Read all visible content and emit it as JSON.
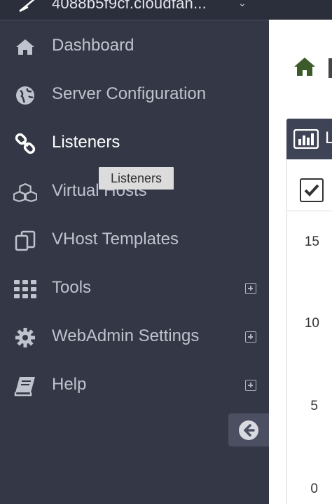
{
  "topbar": {
    "hostname": "4088b5f9cf.cloudfan...",
    "caret": "⌄"
  },
  "sidebar": {
    "items": [
      {
        "label": "Dashboard",
        "icon": "home-icon",
        "expandable": false
      },
      {
        "label": "Server Configuration",
        "icon": "globe-icon",
        "expandable": false
      },
      {
        "label": "Listeners",
        "icon": "link-icon",
        "expandable": false,
        "active": true
      },
      {
        "label": "Virtual Hosts",
        "icon": "cubes-icon",
        "expandable": false
      },
      {
        "label": "VHost Templates",
        "icon": "copy-icon",
        "expandable": false
      },
      {
        "label": "Tools",
        "icon": "grid-icon",
        "expandable": true
      },
      {
        "label": "WebAdmin Settings",
        "icon": "gear-icon",
        "expandable": true
      },
      {
        "label": "Help",
        "icon": "book-icon",
        "expandable": true
      }
    ],
    "tooltip": "Listeners"
  },
  "main": {
    "panel_header_text": "L",
    "y_ticks": [
      "15",
      "10",
      "5",
      "0"
    ]
  },
  "colors": {
    "sidebar_bg": "#343746",
    "topbar_bg": "#2b2e3b",
    "accent_green": "#3d5a2a",
    "panel_header_bg": "#3f4356"
  }
}
